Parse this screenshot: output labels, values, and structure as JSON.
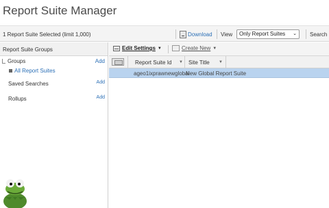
{
  "app": {
    "title": "Report Suite Manager"
  },
  "toolbar": {
    "selection_status": "1 Report Suite Selected (limit 1,000)",
    "download_label": "Download",
    "view_label": "View",
    "view_selected": "Only Report Suites",
    "search_label": "Search"
  },
  "left_pane": {
    "header": "Report Suite Groups",
    "groups_label": "Groups",
    "groups_add": "Add",
    "all_report_suites": "All Report Suites",
    "saved_searches_label": "Saved Searches",
    "saved_searches_add": "Add",
    "rollups_label": "Rollups",
    "rollups_add": "Add"
  },
  "main_toolbar": {
    "edit_settings_label": "Edit Settings",
    "create_new_label": "Create New"
  },
  "grid": {
    "columns": [
      "Report Suite Id",
      "Site Title"
    ],
    "rows": [
      {
        "report_suite_id": "ageo1ixprawnewglobal",
        "site_title": "New Global Report Suite",
        "selected": true
      }
    ]
  },
  "colors": {
    "selected_row": "#b9d3ef",
    "link": "#2b6fb6"
  }
}
